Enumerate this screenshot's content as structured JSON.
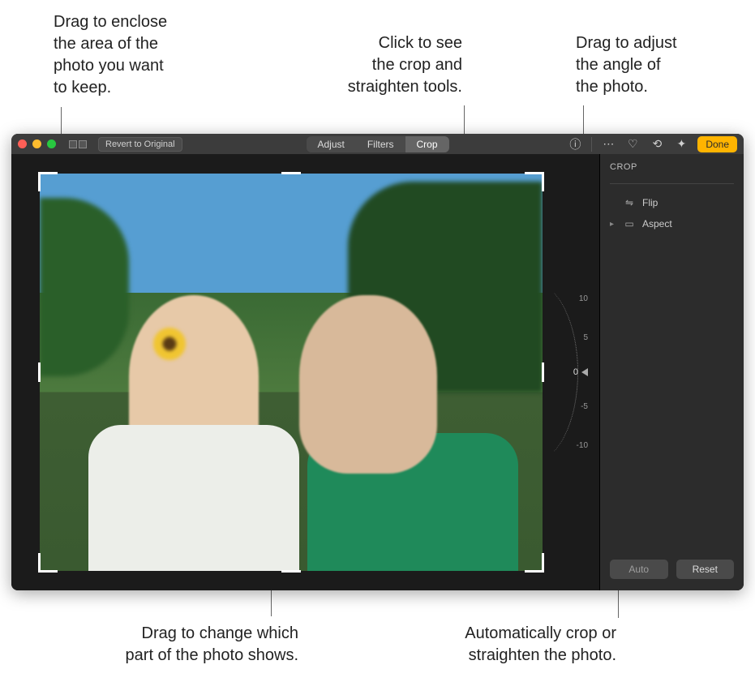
{
  "callouts": {
    "enclose": "Drag to enclose\nthe area of the\nphoto you want\nto keep.",
    "click_crop": "Click to see\nthe crop and\nstraighten tools.",
    "angle": "Drag to adjust\nthe angle of\nthe photo.",
    "drag_change": "Drag to change which\npart of the photo shows.",
    "auto": "Automatically crop or\nstraighten the photo."
  },
  "toolbar": {
    "revert": "Revert to Original",
    "adjust": "Adjust",
    "filters": "Filters",
    "crop": "Crop",
    "done": "Done"
  },
  "sidebar": {
    "title": "CROP",
    "flip": "Flip",
    "aspect": "Aspect",
    "auto": "Auto",
    "reset": "Reset"
  },
  "dial": {
    "p10": "10",
    "p5": "5",
    "zero": "0",
    "m5": "-5",
    "m10": "-10"
  }
}
